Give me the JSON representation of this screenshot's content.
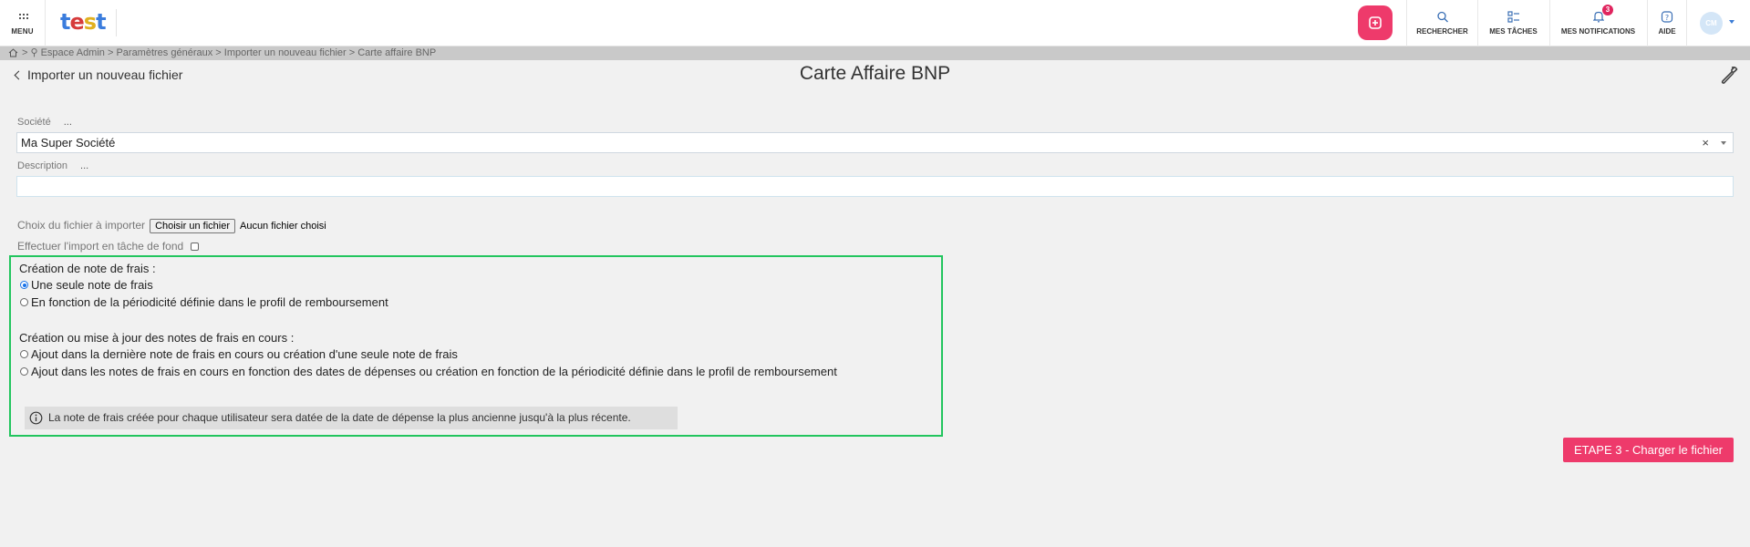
{
  "topbar": {
    "menu_label": "MENU",
    "logo_text": "test",
    "logo_colors": [
      "#3b7ddd",
      "#d63b3b",
      "#e0b020",
      "#3b7ddd"
    ],
    "search_label": "RECHERCHER",
    "tasks_label": "MES TÂCHES",
    "notifications_label": "MES NOTIFICATIONS",
    "notifications_count": "3",
    "help_label": "AIDE",
    "avatar_initials": "CM",
    "accent_color": "#ee3a6b"
  },
  "breadcrumb": {
    "text": "> ⚲ Espace Admin > Paramètres généraux > Importer un nouveau fichier > Carte affaire BNP"
  },
  "header": {
    "back_label": "Importer un nouveau fichier",
    "title": "Carte Affaire BNP"
  },
  "form": {
    "company_label": "Société",
    "company_more": "...",
    "company_value": "Ma Super Société",
    "company_clear": "×",
    "description_label": "Description",
    "description_more": "...",
    "description_value": "",
    "file_label": "Choix du fichier à importer",
    "file_button": "Choisir un fichier",
    "file_status": "Aucun fichier choisi",
    "background_label": "Effectuer l'import en tâche de fond"
  },
  "options": {
    "creation_heading": "Création de note de frais :",
    "creation_choices": [
      {
        "label": "Une seule note de frais",
        "selected": true
      },
      {
        "label": "En fonction de la périodicité définie dans le profil de remboursement",
        "selected": false
      }
    ],
    "update_heading": "Création ou mise à jour des notes de frais en cours :",
    "update_choices": [
      {
        "label": "Ajout dans la dernière note de frais en cours ou création d'une seule note de frais",
        "selected": false
      },
      {
        "label": "Ajout dans les notes de frais en cours en fonction des dates de dépenses ou création en fonction de la périodicité définie dans le profil de remboursement",
        "selected": false
      }
    ],
    "info_text": "La note de frais créée pour chaque utilisateur sera datée de la date de dépense la plus ancienne jusqu'à la plus récente."
  },
  "actions": {
    "step_button": "ETAPE 3 - Charger le fichier"
  }
}
